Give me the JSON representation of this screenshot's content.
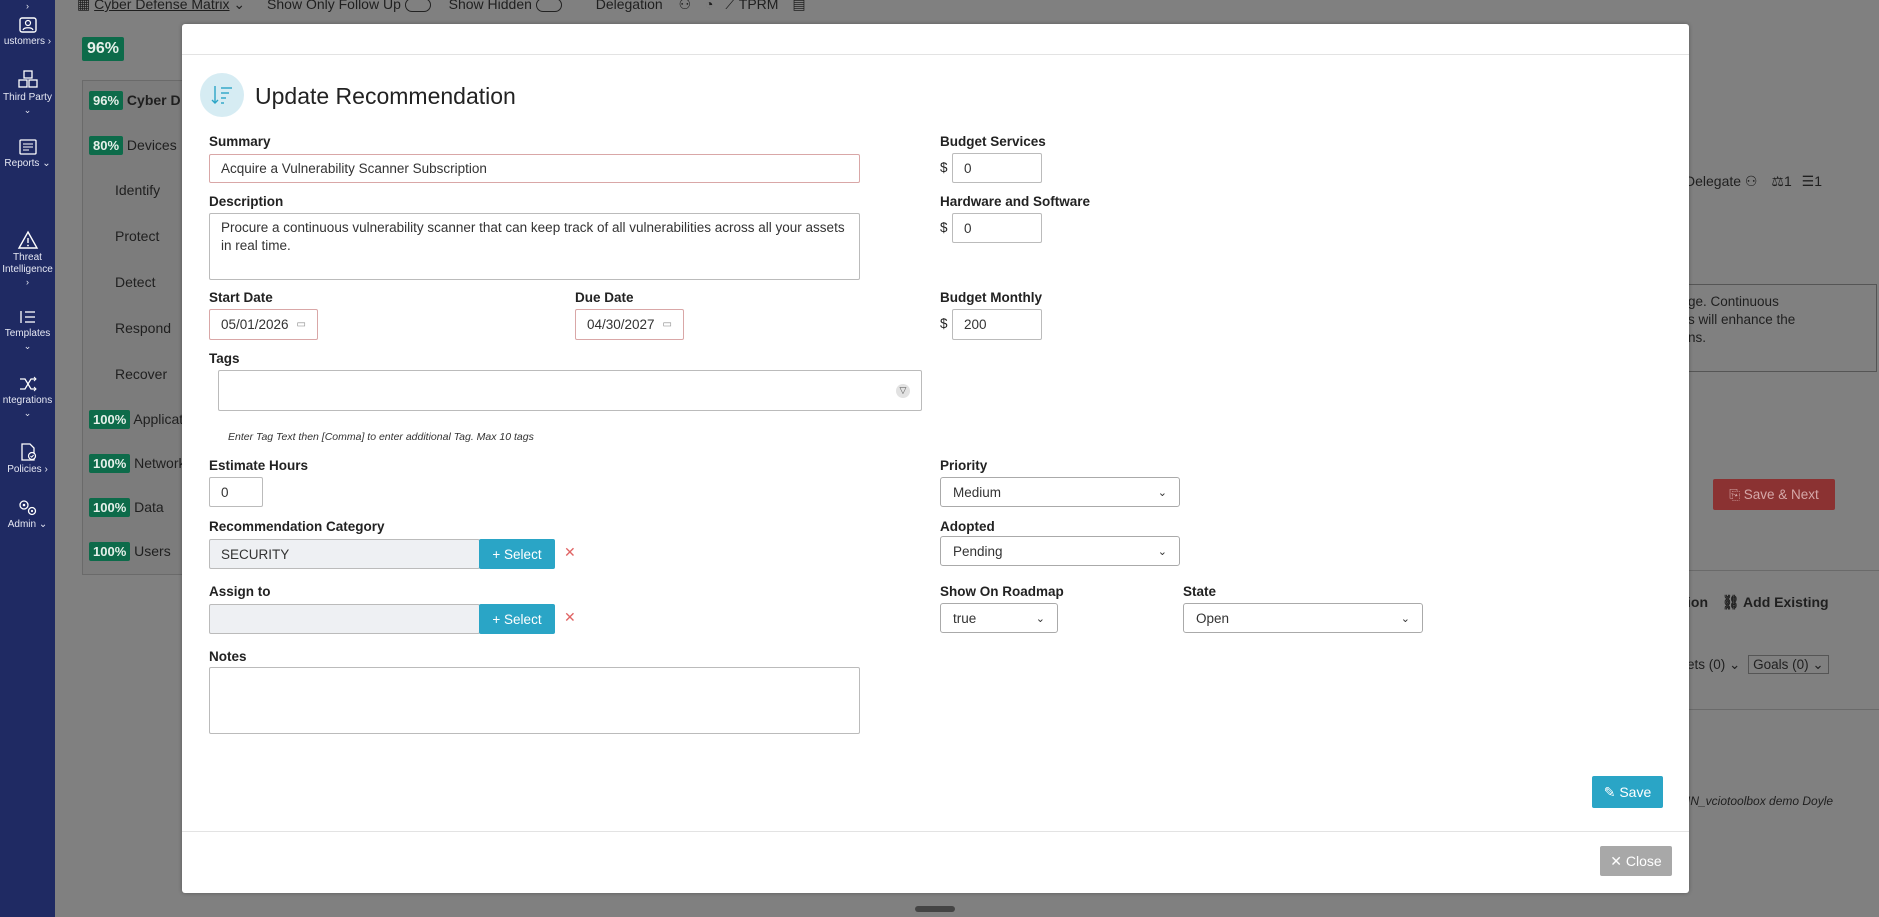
{
  "sidebar": {
    "items": [
      {
        "label": "ustomers",
        "icon": "users-icon"
      },
      {
        "label": "Third Party",
        "icon": "cubes-icon"
      },
      {
        "label": "Reports",
        "icon": "newspaper-icon"
      },
      {
        "label": "Threat Intelligence",
        "icon": "warning-icon"
      },
      {
        "label": "Templates",
        "icon": "list-icon"
      },
      {
        "label": "ntegrations",
        "icon": "shuffle-icon"
      },
      {
        "label": "Policies",
        "icon": "file-check-icon"
      },
      {
        "label": "Admin",
        "icon": "gears-icon"
      }
    ]
  },
  "topbar": {
    "matrix_label": "Cyber Defense Matrix",
    "follow_up": "Show Only Follow Up",
    "hidden": "Show Hidden",
    "delegation": "Delegation",
    "tprm": "TPRM"
  },
  "background": {
    "overall_pct": "96%",
    "matrix_row": {
      "pct": "96%",
      "label": "Cyber D"
    },
    "devices": {
      "pct": "80%",
      "label": "Devices"
    },
    "functions": [
      "Identify",
      "Protect",
      "Detect",
      "Respond",
      "Recover"
    ],
    "rows": [
      {
        "pct": "100%",
        "label": "Applicat"
      },
      {
        "pct": "100%",
        "label": "Networks"
      },
      {
        "pct": "100%",
        "label": "Data"
      },
      {
        "pct": "100%",
        "label": "Users"
      }
    ],
    "delegate": "Delegate",
    "count_a": "1",
    "count_b": "1",
    "desc_lines": [
      "ge. Continuous",
      "s will enhance the",
      "ns."
    ],
    "save_next": "Save & Next",
    "tab_partial": "ion",
    "add_existing": "Add Existing",
    "assets_filter": "ets (0)",
    "goals_filter": "Goals (0)",
    "footer_user": "IN_vciotoolbox demo Doyle"
  },
  "modal": {
    "title": "Update Recommendation",
    "summary_label": "Summary",
    "summary_value": "Acquire a Vulnerability Scanner Subscription",
    "description_label": "Description",
    "description_value": "Procure a continuous vulnerability scanner that can keep track of all vulnerabilities across all your assets in real time.",
    "start_date_label": "Start Date",
    "start_date_value": "05/01/2026",
    "due_date_label": "Due Date",
    "due_date_value": "04/30/2027",
    "tags_label": "Tags",
    "tags_hint": "Enter Tag Text then [Comma] to enter additional Tag. Max 10 tags",
    "estimate_label": "Estimate Hours",
    "estimate_value": "0",
    "category_label": "Recommendation Category",
    "category_value": "SECURITY",
    "select_label": "Select",
    "assign_label": "Assign to",
    "assign_value": "",
    "notes_label": "Notes",
    "budget_services_label": "Budget Services",
    "budget_services_value": "0",
    "hardware_label": "Hardware and Software",
    "hardware_value": "0",
    "budget_monthly_label": "Budget Monthly",
    "budget_monthly_value": "200",
    "currency": "$",
    "priority_label": "Priority",
    "priority_value": "Medium",
    "adopted_label": "Adopted",
    "adopted_value": "Pending",
    "roadmap_label": "Show On Roadmap",
    "roadmap_value": "true",
    "state_label": "State",
    "state_value": "Open",
    "save_label": "Save",
    "close_label": "Close"
  }
}
